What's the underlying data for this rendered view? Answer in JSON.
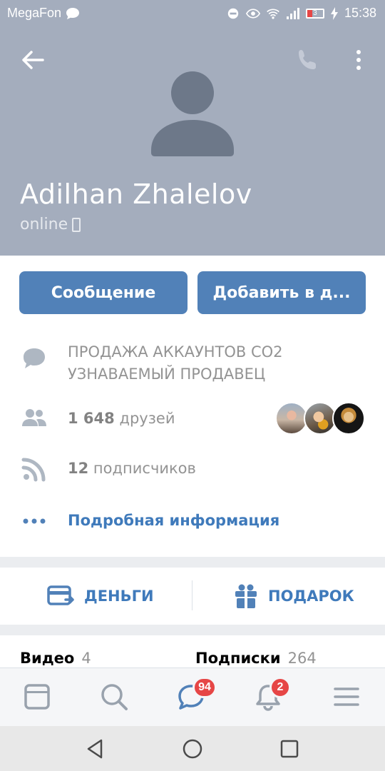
{
  "status_bar": {
    "carrier": "MegaFon",
    "battery": "3",
    "time": "15:38"
  },
  "profile": {
    "name": "Adilhan Zhalelov",
    "status": "online"
  },
  "actions": {
    "message_label": "Сообщение",
    "add_label": "Добавить в д..."
  },
  "info": {
    "status_text_line1": "ПРОДАЖА АККАУНТОВ CO2",
    "status_text_line2": "УЗНАВАЕМЫЙ ПРОДАВЕЦ",
    "friends_count": "1 648",
    "friends_label": "друзей",
    "followers_count": "12",
    "followers_label": "подписчиков",
    "details_label": "Подробная информация"
  },
  "extras": {
    "money_label": "ДЕНЬГИ",
    "gift_label": "ПОДАРОК"
  },
  "counters": {
    "video_label": "Видео",
    "video_count": "4",
    "subs_label": "Подписки",
    "subs_count": "264"
  },
  "tabbar": {
    "messages_badge": "94",
    "notifications_badge": "2"
  },
  "colors": {
    "header_bg": "#a4adbd",
    "accent": "#5181b8",
    "link": "#3f7abb",
    "badge": "#e64646"
  },
  "icons": [
    "chat-bubble-icon",
    "minus-circle-icon",
    "eye-icon",
    "wifi-icon",
    "signal-icon",
    "battery-icon",
    "bolt-icon",
    "back-arrow-icon",
    "phone-icon",
    "more-vertical-icon",
    "avatar-placeholder-icon",
    "mobile-icon",
    "comment-icon",
    "friends-icon",
    "rss-icon",
    "dots-icon",
    "card-icon",
    "gift-icon",
    "news-icon",
    "search-icon",
    "messages-icon",
    "bell-icon",
    "menu-icon",
    "nav-back-icon",
    "nav-home-icon",
    "nav-recents-icon"
  ]
}
